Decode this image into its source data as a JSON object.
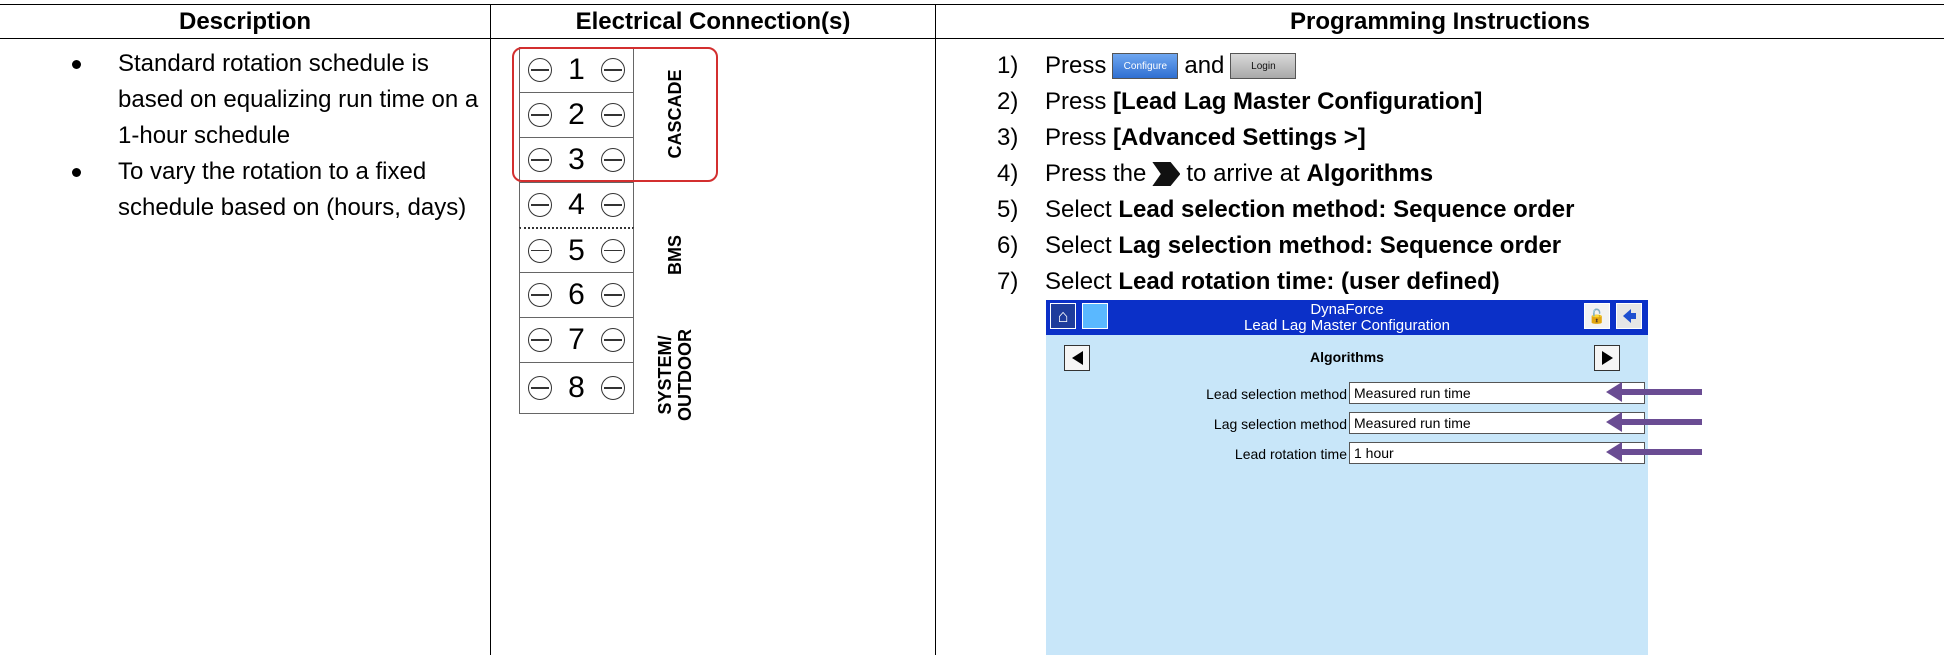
{
  "table": {
    "headers": [
      "Description",
      "Electrical Connection(s)",
      "Programming Instructions"
    ]
  },
  "description": {
    "items": [
      "Standard rotation schedule is based on equalizing run time on a 1-hour schedule",
      "To vary the rotation to a fixed schedule based on (hours, days)"
    ]
  },
  "terminal_block": {
    "numbers": [
      "1",
      "2",
      "3",
      "4",
      "5",
      "6",
      "7",
      "8"
    ],
    "labels": {
      "cascade": "CASCADE",
      "bms": "BMS",
      "system_outdoor_line1": "SYSTEM/",
      "system_outdoor_line2": "OUTDOOR"
    },
    "highlight_color": "#d32f2f"
  },
  "instructions": {
    "step1": {
      "num": "1)",
      "prefix": "Press",
      "configure_btn": "Configure",
      "mid": "and",
      "login_btn": "Login"
    },
    "step2": {
      "num": "2)",
      "prefix": "Press",
      "bold": "[Lead Lag Master Configuration]"
    },
    "step3": {
      "num": "3)",
      "prefix": "Press",
      "bold": "[Advanced Settings >]"
    },
    "step4": {
      "num": "4)",
      "prefix": "Press the",
      "icon": "next-arrow-icon",
      "mid": "to arrive at",
      "bold": "Algorithms"
    },
    "step5": {
      "num": "5)",
      "prefix": "Select",
      "bold": "Lead selection method: Sequence order"
    },
    "step6": {
      "num": "6)",
      "prefix": "Select",
      "bold": "Lag selection method: Sequence order"
    },
    "step7": {
      "num": "7)",
      "prefix": "Select",
      "bold": "Lead rotation time: (user defined)"
    }
  },
  "screen": {
    "title_line1": "DynaForce",
    "title_line2": "Lead Lag Master Configuration",
    "heading": "Algorithms",
    "fields": [
      {
        "label": "Lead selection method",
        "value": "Measured run time"
      },
      {
        "label": "Lag selection method",
        "value": "Measured run time"
      },
      {
        "label": "Lead rotation time",
        "value": "1 hour"
      }
    ],
    "colors": {
      "bar": "#0b30c8",
      "body": "#c8e6f9",
      "arrow": "#6a4c93"
    },
    "icons": [
      "home-icon",
      "camera-icon",
      "lock-icon",
      "back-icon",
      "prev-page-icon",
      "next-page-icon"
    ]
  }
}
